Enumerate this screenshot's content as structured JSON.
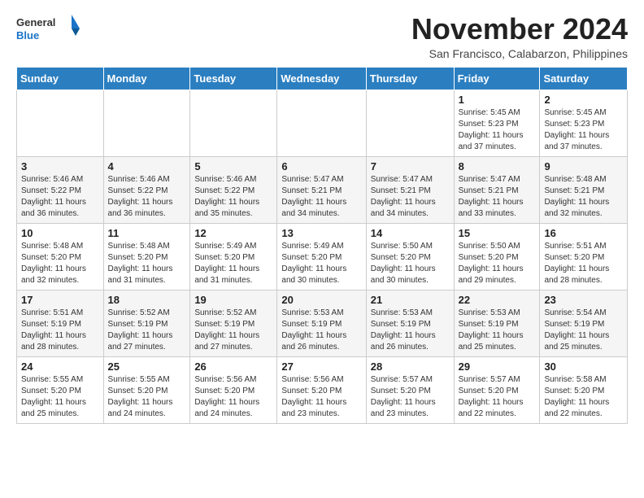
{
  "header": {
    "logo_line1": "General",
    "logo_line2": "Blue",
    "month": "November 2024",
    "location": "San Francisco, Calabarzon, Philippines"
  },
  "weekdays": [
    "Sunday",
    "Monday",
    "Tuesday",
    "Wednesday",
    "Thursday",
    "Friday",
    "Saturday"
  ],
  "weeks": [
    [
      {
        "day": "",
        "info": ""
      },
      {
        "day": "",
        "info": ""
      },
      {
        "day": "",
        "info": ""
      },
      {
        "day": "",
        "info": ""
      },
      {
        "day": "",
        "info": ""
      },
      {
        "day": "1",
        "info": "Sunrise: 5:45 AM\nSunset: 5:23 PM\nDaylight: 11 hours and 37 minutes."
      },
      {
        "day": "2",
        "info": "Sunrise: 5:45 AM\nSunset: 5:23 PM\nDaylight: 11 hours and 37 minutes."
      }
    ],
    [
      {
        "day": "3",
        "info": "Sunrise: 5:46 AM\nSunset: 5:22 PM\nDaylight: 11 hours and 36 minutes."
      },
      {
        "day": "4",
        "info": "Sunrise: 5:46 AM\nSunset: 5:22 PM\nDaylight: 11 hours and 36 minutes."
      },
      {
        "day": "5",
        "info": "Sunrise: 5:46 AM\nSunset: 5:22 PM\nDaylight: 11 hours and 35 minutes."
      },
      {
        "day": "6",
        "info": "Sunrise: 5:47 AM\nSunset: 5:21 PM\nDaylight: 11 hours and 34 minutes."
      },
      {
        "day": "7",
        "info": "Sunrise: 5:47 AM\nSunset: 5:21 PM\nDaylight: 11 hours and 34 minutes."
      },
      {
        "day": "8",
        "info": "Sunrise: 5:47 AM\nSunset: 5:21 PM\nDaylight: 11 hours and 33 minutes."
      },
      {
        "day": "9",
        "info": "Sunrise: 5:48 AM\nSunset: 5:21 PM\nDaylight: 11 hours and 32 minutes."
      }
    ],
    [
      {
        "day": "10",
        "info": "Sunrise: 5:48 AM\nSunset: 5:20 PM\nDaylight: 11 hours and 32 minutes."
      },
      {
        "day": "11",
        "info": "Sunrise: 5:48 AM\nSunset: 5:20 PM\nDaylight: 11 hours and 31 minutes."
      },
      {
        "day": "12",
        "info": "Sunrise: 5:49 AM\nSunset: 5:20 PM\nDaylight: 11 hours and 31 minutes."
      },
      {
        "day": "13",
        "info": "Sunrise: 5:49 AM\nSunset: 5:20 PM\nDaylight: 11 hours and 30 minutes."
      },
      {
        "day": "14",
        "info": "Sunrise: 5:50 AM\nSunset: 5:20 PM\nDaylight: 11 hours and 30 minutes."
      },
      {
        "day": "15",
        "info": "Sunrise: 5:50 AM\nSunset: 5:20 PM\nDaylight: 11 hours and 29 minutes."
      },
      {
        "day": "16",
        "info": "Sunrise: 5:51 AM\nSunset: 5:20 PM\nDaylight: 11 hours and 28 minutes."
      }
    ],
    [
      {
        "day": "17",
        "info": "Sunrise: 5:51 AM\nSunset: 5:19 PM\nDaylight: 11 hours and 28 minutes."
      },
      {
        "day": "18",
        "info": "Sunrise: 5:52 AM\nSunset: 5:19 PM\nDaylight: 11 hours and 27 minutes."
      },
      {
        "day": "19",
        "info": "Sunrise: 5:52 AM\nSunset: 5:19 PM\nDaylight: 11 hours and 27 minutes."
      },
      {
        "day": "20",
        "info": "Sunrise: 5:53 AM\nSunset: 5:19 PM\nDaylight: 11 hours and 26 minutes."
      },
      {
        "day": "21",
        "info": "Sunrise: 5:53 AM\nSunset: 5:19 PM\nDaylight: 11 hours and 26 minutes."
      },
      {
        "day": "22",
        "info": "Sunrise: 5:53 AM\nSunset: 5:19 PM\nDaylight: 11 hours and 25 minutes."
      },
      {
        "day": "23",
        "info": "Sunrise: 5:54 AM\nSunset: 5:19 PM\nDaylight: 11 hours and 25 minutes."
      }
    ],
    [
      {
        "day": "24",
        "info": "Sunrise: 5:55 AM\nSunset: 5:20 PM\nDaylight: 11 hours and 25 minutes."
      },
      {
        "day": "25",
        "info": "Sunrise: 5:55 AM\nSunset: 5:20 PM\nDaylight: 11 hours and 24 minutes."
      },
      {
        "day": "26",
        "info": "Sunrise: 5:56 AM\nSunset: 5:20 PM\nDaylight: 11 hours and 24 minutes."
      },
      {
        "day": "27",
        "info": "Sunrise: 5:56 AM\nSunset: 5:20 PM\nDaylight: 11 hours and 23 minutes."
      },
      {
        "day": "28",
        "info": "Sunrise: 5:57 AM\nSunset: 5:20 PM\nDaylight: 11 hours and 23 minutes."
      },
      {
        "day": "29",
        "info": "Sunrise: 5:57 AM\nSunset: 5:20 PM\nDaylight: 11 hours and 22 minutes."
      },
      {
        "day": "30",
        "info": "Sunrise: 5:58 AM\nSunset: 5:20 PM\nDaylight: 11 hours and 22 minutes."
      }
    ]
  ]
}
